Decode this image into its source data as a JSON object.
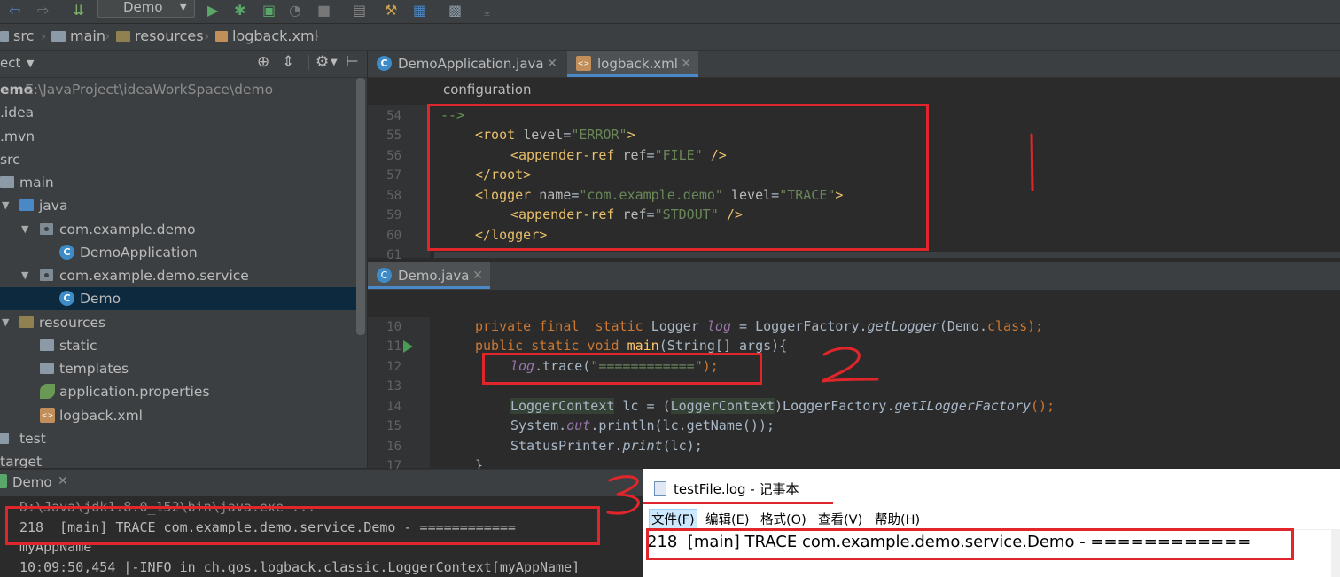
{
  "toolbar": {
    "run_config": "Demo",
    "icons": [
      "back-icon",
      "forward-icon",
      "build-icon",
      "run-icon",
      "debug-icon",
      "coverage-icon",
      "profile-icon",
      "stop-icon",
      "settings-icon",
      "structure-icon",
      "sdk-icon",
      "download-icon"
    ]
  },
  "breadcrumb": [
    "src",
    "main",
    "resources",
    "logback.xml"
  ],
  "project_panel": {
    "header": "ect",
    "root": {
      "name": "emo",
      "path": "E:\\JavaProject\\ideaWorkSpace\\demo"
    },
    "items": [
      ".idea",
      ".mvn",
      "src",
      "main",
      "java",
      "com.example.demo",
      "DemoApplication",
      "com.example.demo.service",
      "Demo",
      "resources",
      "static",
      "templates",
      "application.properties",
      "logback.xml",
      "test",
      "target"
    ]
  },
  "editor_top": {
    "tabs": [
      "DemoApplication.java",
      "logback.xml"
    ],
    "crumb": "configuration",
    "line_numbers": [
      "54",
      "55",
      "56",
      "57",
      "58",
      "59",
      "60",
      "61"
    ],
    "lines": {
      "l54": "-->",
      "root_open_tag": "root",
      "root_attr": "level",
      "root_val": "\"ERROR\"",
      "appender1_tag": "appender-ref",
      "appender1_attr": "ref",
      "appender1_val": "\"FILE\"",
      "root_close": "/root",
      "logger_tag": "logger",
      "logger_attr1": "name",
      "logger_val1": "\"com.example.demo\"",
      "logger_attr2": "level",
      "logger_val2": "\"TRACE\"",
      "appender2_tag": "appender-ref",
      "appender2_attr": "ref",
      "appender2_val": "\"STDOUT\"",
      "logger_close": "/logger"
    }
  },
  "editor_bottom": {
    "tab": "Demo.java",
    "line_numbers": [
      "10",
      "11",
      "12",
      "13",
      "14",
      "15",
      "16",
      "17"
    ],
    "line10": {
      "kw": "private final  static ",
      "type": "Logger ",
      "var": "log",
      "rest1": " = LoggerFactory.",
      "method": "getLogger",
      "rest2": "(Demo.",
      "cls": "class",
      "end": ");"
    },
    "line11": {
      "kw": "public static void ",
      "method": "main",
      "rest": "(String[] args){"
    },
    "line12": {
      "var": "log",
      "rest": ".trace(",
      "str": "\"============\"",
      "end": ");"
    },
    "line14": {
      "type1": "LoggerContext",
      "rest1": " lc = (",
      "type2": "LoggerContext",
      "rest2": ")LoggerFactory.",
      "method": "getILoggerFactory",
      "end": "();"
    },
    "line15": {
      "a": "System.",
      "field": "out",
      "b": ".println(lc.getName());"
    },
    "line16": {
      "a": "StatusPrinter.",
      "method": "print",
      "b": "(lc);"
    },
    "line17": "}"
  },
  "run_panel": {
    "tab": "Demo",
    "lines": [
      "D:\\Java\\jdk1.8.0_152\\bin\\java.exe ...",
      "218  [main] TRACE com.example.demo.service.Demo - ============",
      "myAppName",
      "10:09:50,454 |-INFO in ch.qos.logback.classic.LoggerContext[myAppName]"
    ]
  },
  "notepad": {
    "title": "testFile.log - 记事本",
    "menu": [
      "文件(F)",
      "编辑(E)",
      "格式(O)",
      "查看(V)",
      "帮助(H)"
    ],
    "content": "218  [main] TRACE com.example.demo.service.Demo - ============"
  },
  "annotations": {
    "mark1": "1",
    "mark2": "2",
    "mark3": "3"
  }
}
